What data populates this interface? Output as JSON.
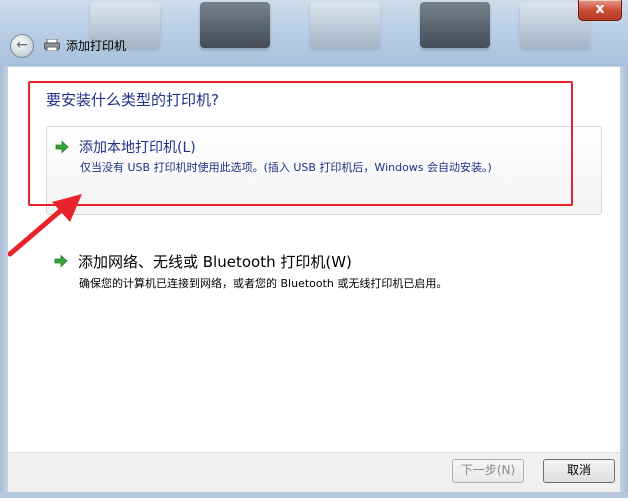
{
  "window": {
    "title": "添加打印机",
    "close_label": "x"
  },
  "header": {
    "question": "要安装什么类型的打印机?"
  },
  "options": [
    {
      "title": "添加本地打印机(L)",
      "description": "仅当没有 USB 打印机时使用此选项。(插入 USB 打印机后，Windows 会自动安装。)",
      "selected": true
    },
    {
      "title": "添加网络、无线或 Bluetooth 打印机(W)",
      "description": "确保您的计算机已连接到网络，或者您的 Bluetooth 或无线打印机已启用。",
      "selected": false
    }
  ],
  "footer": {
    "next_label": "下一步(N)",
    "next_enabled": false,
    "cancel_label": "取消"
  },
  "icons": {
    "back": "back-arrow-icon",
    "printer": "printer-icon",
    "option_arrow": "green-arrow-icon"
  },
  "colors": {
    "link_blue": "#1e3287",
    "highlight_red": "#e8232a",
    "arrow_green": "#3aa33a"
  }
}
